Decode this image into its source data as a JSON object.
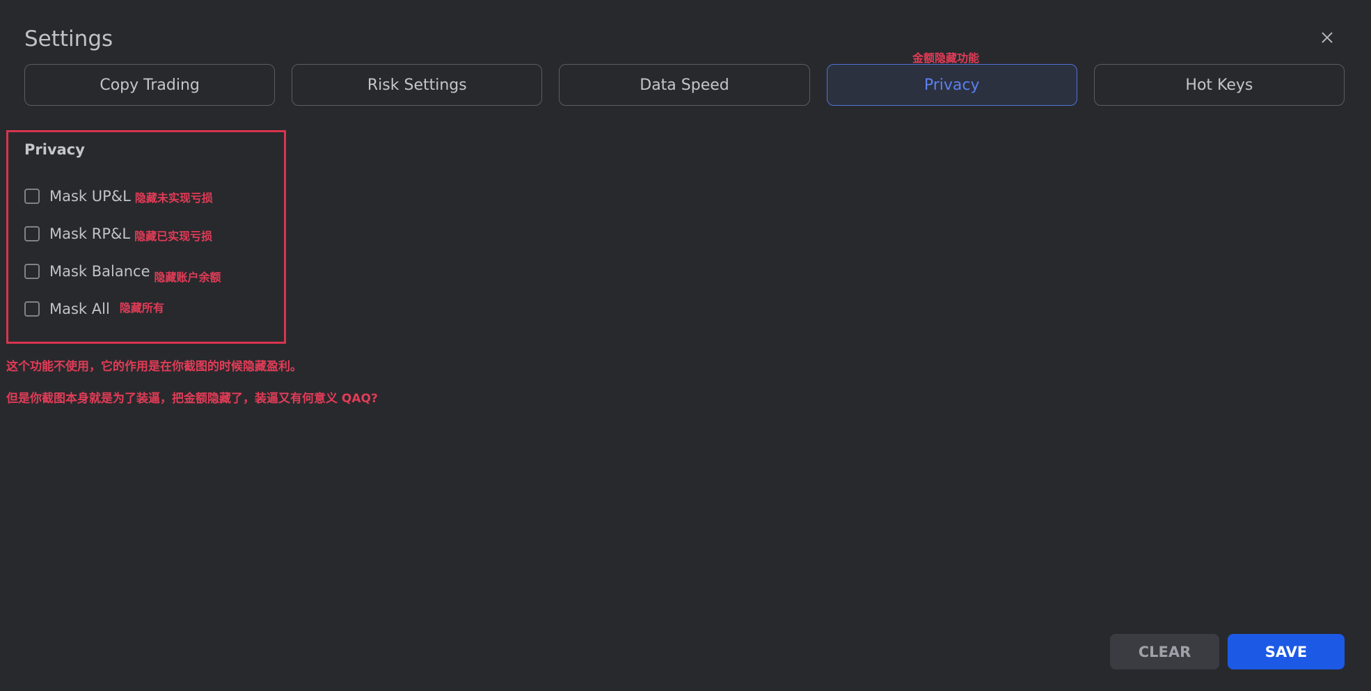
{
  "header": {
    "title": "Settings",
    "close_icon": "close-icon"
  },
  "tabs": [
    {
      "label": "Copy Trading",
      "active": false
    },
    {
      "label": "Risk Settings",
      "active": false
    },
    {
      "label": "Data Speed",
      "active": false
    },
    {
      "label": "Privacy",
      "active": true
    },
    {
      "label": "Hot Keys",
      "active": false
    }
  ],
  "annotations": {
    "privacy_tab_note": "金额隐藏功能",
    "line1": "这个功能不使用，它的作用是在你截图的时候隐藏盈利。",
    "line2": "但是你截图本身就是为了装逼，把金额隐藏了，装逼又有何意义 QAQ?"
  },
  "privacy": {
    "section_title": "Privacy",
    "options": [
      {
        "label": "Mask UP&L",
        "note": "隐藏未实现亏损",
        "checked": false
      },
      {
        "label": "Mask RP&L",
        "note": "隐藏已实现亏损",
        "checked": false
      },
      {
        "label": "Mask Balance",
        "note": "隐藏账户余额",
        "checked": false
      },
      {
        "label": "Mask All",
        "note": "隐藏所有",
        "checked": false
      }
    ]
  },
  "footer": {
    "clear_label": "CLEAR",
    "save_label": "SAVE"
  },
  "colors": {
    "background": "#28292d",
    "accent": "#1c5ae6",
    "active_tab_text": "#5b80f0",
    "annotation_red": "#e23c57"
  }
}
